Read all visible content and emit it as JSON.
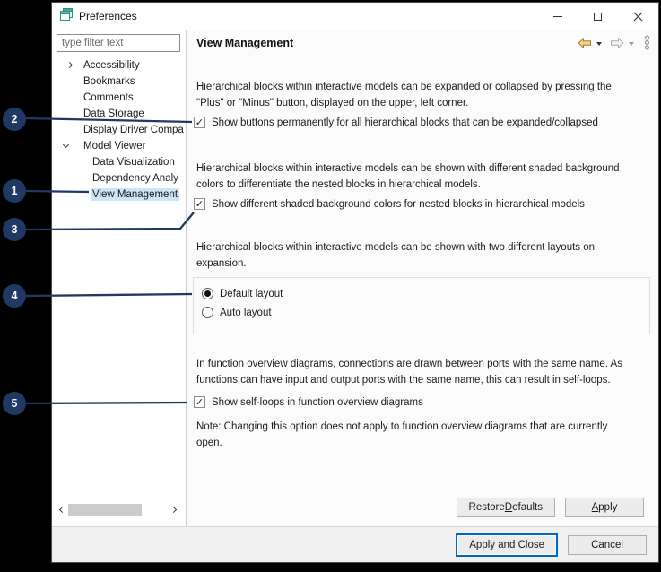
{
  "window": {
    "title": "Preferences"
  },
  "sidebar": {
    "filter_placeholder": "type filter text",
    "items": [
      {
        "label": "Accessibility",
        "level": 0,
        "expander": "collapsed",
        "selected": false
      },
      {
        "label": "Bookmarks",
        "level": 0,
        "expander": null,
        "selected": false
      },
      {
        "label": "Comments",
        "level": 0,
        "expander": null,
        "selected": false
      },
      {
        "label": "Data Storage",
        "level": 0,
        "expander": null,
        "selected": false
      },
      {
        "label": "Display Driver Compa",
        "level": 0,
        "expander": null,
        "selected": false
      },
      {
        "label": "Model Viewer",
        "level": 0,
        "expander": "expanded",
        "selected": false
      },
      {
        "label": "Data Visualization",
        "level": 1,
        "expander": null,
        "selected": false
      },
      {
        "label": "Dependency Analy",
        "level": 1,
        "expander": null,
        "selected": false
      },
      {
        "label": "View Management",
        "level": 1,
        "expander": null,
        "selected": true
      }
    ]
  },
  "header": {
    "title": "View Management"
  },
  "main": {
    "intro_expand": "Hierarchical blocks within interactive models can be expanded or collapsed by pressing the\n\"Plus\" or \"Minus\" button, displayed on the upper, left corner.",
    "checkbox_buttons": {
      "label": "Show buttons permanently for all hierarchical blocks that can be expanded/collapsed",
      "checked": true
    },
    "intro_shaded": "Hierarchical blocks within interactive models can be shown with different shaded background\ncolors to differentiate the nested blocks in hierarchical models.",
    "checkbox_shaded": {
      "label": "Show different shaded background colors for nested blocks in hierarchical models",
      "checked": true
    },
    "intro_layout": "Hierarchical blocks within interactive models can be shown with two different layouts on\nexpansion.",
    "layout_options": [
      {
        "label": "Default layout",
        "selected": true
      },
      {
        "label": "Auto layout",
        "selected": false
      }
    ],
    "intro_selfloops": "In function overview diagrams, connections are drawn between ports with the same name. As\nfunctions can have input and output ports with the same name, this can result in self-loops.",
    "checkbox_selfloops": {
      "label": "Show self-loops in function overview diagrams",
      "checked": true
    },
    "note": "Note: Changing this option does not apply to function overview diagrams that are currently\nopen."
  },
  "buttons": {
    "restore_defaults": {
      "pre": "Restore ",
      "key": "D",
      "post": "efaults"
    },
    "apply": {
      "pre": "",
      "key": "A",
      "post": "pply"
    },
    "apply_and_close": "Apply and Close",
    "cancel": "Cancel"
  },
  "callouts": [
    {
      "num": "1"
    },
    {
      "num": "2"
    },
    {
      "num": "3"
    },
    {
      "num": "4"
    },
    {
      "num": "5"
    }
  ],
  "icons": {
    "check": "✓"
  },
  "colors": {
    "callout": "#1f3864",
    "tree_selection": "#cbe6fb",
    "primary_button_border": "#0067c0",
    "back_arrow": "#f2d38c"
  }
}
